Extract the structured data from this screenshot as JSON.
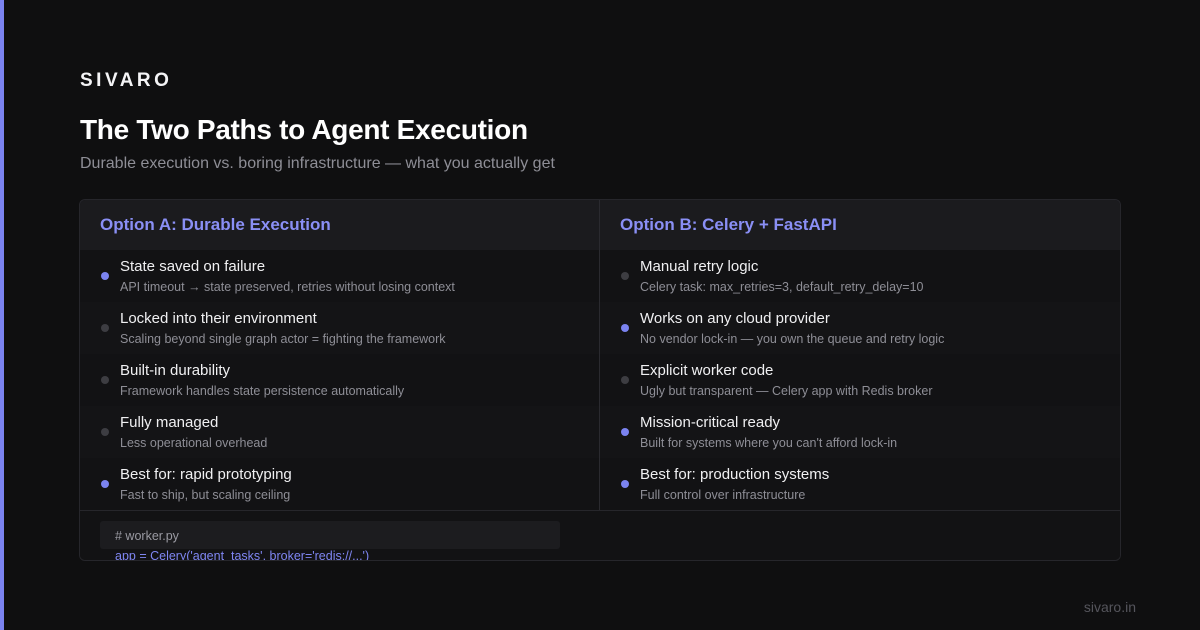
{
  "brand": "SIVARO",
  "title": "The Two Paths to Agent Execution",
  "subtitle": "Durable execution vs. boring infrastructure — what you actually get",
  "accent_color": "#7b83f0",
  "option_a": {
    "header": "Option A: Durable Execution",
    "items": [
      {
        "title": "State saved on failure",
        "desc": "API timeout → state preserved, retries without losing context",
        "highlight": true
      },
      {
        "title": "Locked into their environment",
        "desc": "Scaling beyond single graph actor = fighting the framework",
        "highlight": false
      },
      {
        "title": "Built-in durability",
        "desc": "Framework handles state persistence automatically",
        "highlight": false
      },
      {
        "title": "Fully managed",
        "desc": "Less operational overhead",
        "highlight": false
      },
      {
        "title": "Best for: rapid prototyping",
        "desc": "Fast to ship, but scaling ceiling",
        "highlight": true
      }
    ]
  },
  "option_b": {
    "header": "Option B: Celery + FastAPI",
    "items": [
      {
        "title": "Manual retry logic",
        "desc": "Celery task: max_retries=3, default_retry_delay=10",
        "highlight": false
      },
      {
        "title": "Works on any cloud provider",
        "desc": "No vendor lock-in — you own the queue and retry logic",
        "highlight": true
      },
      {
        "title": "Explicit worker code",
        "desc": "Ugly but transparent — Celery app with Redis broker",
        "highlight": false
      },
      {
        "title": "Mission-critical ready",
        "desc": "Built for systems where you can't afford lock-in",
        "highlight": true
      },
      {
        "title": "Best for: production systems",
        "desc": "Full control over infrastructure",
        "highlight": true
      }
    ]
  },
  "code": {
    "comment": "# worker.py",
    "line": "app = Celery('agent_tasks', broker='redis://...')"
  },
  "footer": "sivaro.in"
}
